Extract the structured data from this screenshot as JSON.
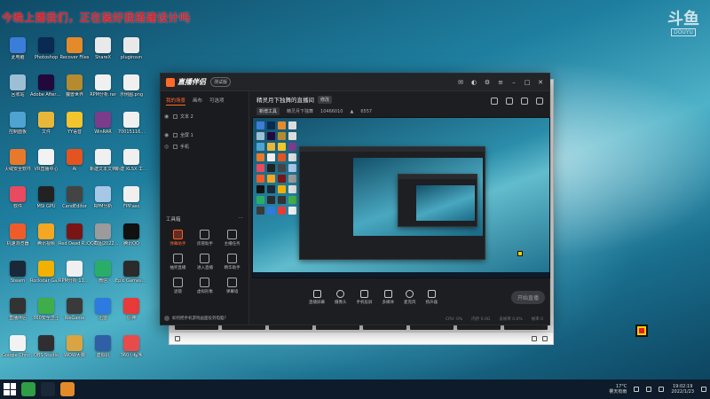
{
  "overlay": {
    "title": "今晚上播我们，正在装好我搭建设计吗",
    "brand_big": "斗鱼",
    "brand_sub": "DOUYU"
  },
  "desktop_icons": [
    {
      "label": "此电脑",
      "color": "#3b7dd8"
    },
    {
      "label": "Photoshop",
      "color": "#0a2a52"
    },
    {
      "label": "Recover Files",
      "color": "#e58a2a"
    },
    {
      "label": "ShareX",
      "color": "#e9e9e9"
    },
    {
      "label": "pluginsvn",
      "color": "#e9e9e9"
    },
    {
      "label": "回收站",
      "color": "#9cbfd6"
    },
    {
      "label": "Adobe After Effects 2020",
      "color": "#21093b"
    },
    {
      "label": "魔兽世界",
      "color": "#b68a2e"
    },
    {
      "label": "RPM分析.rar",
      "color": "#f0f0f0"
    },
    {
      "label": "示例图.png",
      "color": "#f0f0f0"
    },
    {
      "label": "控制面板",
      "color": "#4fa3d1"
    },
    {
      "label": "文件",
      "color": "#e8b73a"
    },
    {
      "label": "YY语音",
      "color": "#f2c42e"
    },
    {
      "label": "WinRAR",
      "color": "#7b3c8c"
    },
    {
      "label": "70015116...",
      "color": "#f0f0f0"
    },
    {
      "label": "火绒安全软件",
      "color": "#e8792c"
    },
    {
      "label": "VR直播中心",
      "color": "#f2f2f2"
    },
    {
      "label": "Ai",
      "color": "#e35420"
    },
    {
      "label": "新建文本文档",
      "color": "#f0f0f0"
    },
    {
      "label": "新建 XLSX 工作表",
      "color": "#f0f0f0"
    },
    {
      "label": "软件",
      "color": "#e84a5f"
    },
    {
      "label": "MSI GPU",
      "color": "#222"
    },
    {
      "label": "CandEditor",
      "color": "#444"
    },
    {
      "label": "RPM分析",
      "color": "#a7c7e7"
    },
    {
      "label": "FPP.ass",
      "color": "#f0f0f0"
    },
    {
      "label": "机速浏览器",
      "color": "#f05b2a"
    },
    {
      "label": "腾讯视频",
      "color": "#f5a623"
    },
    {
      "label": "Red Dead Redemption",
      "color": "#7a1515"
    },
    {
      "label": "QQ截图2022012...",
      "color": "#9b9b9b"
    },
    {
      "label": "腾讯QQ",
      "color": "#111"
    },
    {
      "label": "Steam",
      "color": "#1b2838"
    },
    {
      "label": "Rockstar Games",
      "color": "#f2b000"
    },
    {
      "label": "RPM分析 1111.rar",
      "color": "#f0f0f0"
    },
    {
      "label": "微信",
      "color": "#2aae67"
    },
    {
      "label": "Epic Games Launcher",
      "color": "#2b2b2b"
    },
    {
      "label": "直播伴侣",
      "color": "#333"
    },
    {
      "label": "360安全卫士",
      "color": "#3fae4a"
    },
    {
      "label": "WeGame",
      "color": "#3a3a3a"
    },
    {
      "label": "迅雷",
      "color": "#2d7be0"
    },
    {
      "label": "原神",
      "color": "#e83a3a"
    },
    {
      "label": "Google Chrome",
      "color": "#f2f2f2"
    },
    {
      "label": "OBS Studio",
      "color": "#302e31"
    },
    {
      "label": "WOW大脚",
      "color": "#d9a441"
    },
    {
      "label": "虚拟机",
      "color": "#2f5fa5"
    },
    {
      "label": "360小程序",
      "color": "#e84b4b"
    }
  ],
  "app": {
    "name": "直播伴侣",
    "version": "测试版",
    "tabs": [
      "我的场景",
      "画布",
      "可选项"
    ],
    "scenes": [
      "文本 2",
      "全屏 1",
      "手机"
    ],
    "tools_title": "工具箱",
    "tools": [
      {
        "label": "弹幕助手",
        "hot": true
      },
      {
        "label": "房管助手",
        "hot": false
      },
      {
        "label": "主播任务",
        "hot": false
      },
      {
        "label": "抽奖直播",
        "hot": false
      },
      {
        "label": "进入直播",
        "hot": false
      },
      {
        "label": "精华助手",
        "hot": false
      },
      {
        "label": "滤镜",
        "hot": false
      },
      {
        "label": "虚拟形象",
        "hot": false
      },
      {
        "label": "弹幕墙",
        "hot": false
      }
    ],
    "sidebar_tip": "如何把手机游戏画面投到电脑？",
    "room_title": "精灵月下独舞的直播间",
    "room_edit": "修改",
    "room_category": "新增工具",
    "room_owner": "精灵月下独舞",
    "room_id": "10466010",
    "room_hot": "6557",
    "live_tools": [
      {
        "label": "直播屏幕",
        "round": false
      },
      {
        "label": "摄像头",
        "round": true
      },
      {
        "label": "手机投屏",
        "round": false
      },
      {
        "label": "多媒体",
        "round": false
      },
      {
        "label": "麦克风",
        "round": true
      },
      {
        "label": "扬声器",
        "round": false
      }
    ],
    "start_live": "开始直播",
    "status": [
      "CPU: 0%",
      "内存 0.0G",
      "丢帧率 0.0%",
      "帧率 0"
    ]
  },
  "taskbar": {
    "weather": "17°C",
    "weather_sub": "雾天有雨",
    "time": "19:02:19",
    "date": "2022/1/23"
  }
}
